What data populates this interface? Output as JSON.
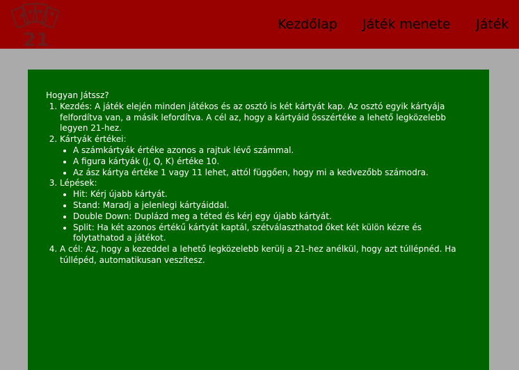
{
  "header": {
    "logo_text": "21",
    "nav": {
      "home": "Kezdőlap",
      "rules": "Játék menete",
      "play": "Játék"
    }
  },
  "colors": {
    "header_bg": "#990000",
    "page_bg": "#aaaaaa",
    "panel_bg": "#006400",
    "text": "#ffffff",
    "logo": "#6b1d1d"
  },
  "icons": [
    "cards-logo-icon"
  ],
  "rules": {
    "title": "Hogyan Játssz?",
    "steps": [
      {
        "text": "Kezdés: A játék elején minden játékos és az osztó is két kártyát kap. Az osztó egyik kártyája felfordítva van, a másik lefordítva. A cél az, hogy a kártyáid összértéke a lehető legközelebb legyen 21-hez."
      },
      {
        "text": "Kártyák értékei:",
        "sub": [
          "A számkártyák értéke azonos a rajtuk lévő számmal.",
          "A figura kártyák (J, Q, K) értéke 10.",
          "Az ász kártya értéke 1 vagy 11 lehet, attól függően, hogy mi a kedvezőbb számodra."
        ]
      },
      {
        "text": "Lépések:",
        "sub": [
          "Hit: Kérj újabb kártyát.",
          "Stand: Maradj a jelenlegi kártyáiddal.",
          "Double Down: Duplázd meg a téted és kérj egy újabb kártyát.",
          "Split: Ha két azonos értékű kártyát kaptál, szétválaszthatod őket két külön kézre és folytathatod a játékot."
        ]
      },
      {
        "text": "A cél: Az, hogy a kezeddel a lehető legközelebb kerülj a 21-hez anélkül, hogy azt túllépnéd. Ha túllépéd, automatikusan veszítesz."
      }
    ]
  }
}
